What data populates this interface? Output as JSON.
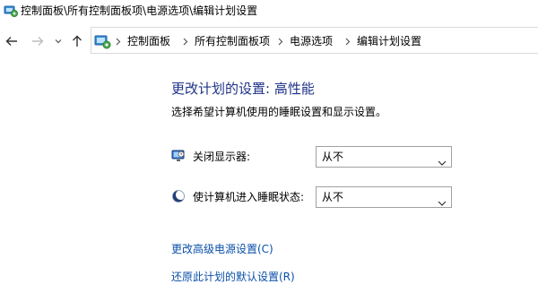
{
  "window": {
    "title": "控制面板\\所有控制面板项\\电源选项\\编辑计划设置",
    "title_icon": "control-panel-icon"
  },
  "navigation": {
    "back_icon": "back-arrow-icon",
    "forward_icon": "forward-arrow-icon",
    "recent_icon": "chevron-down-icon",
    "up_icon": "up-arrow-icon"
  },
  "breadcrumb": {
    "icon": "control-panel-icon",
    "items": [
      "控制面板",
      "所有控制面板项",
      "电源选项",
      "编辑计划设置"
    ]
  },
  "main": {
    "heading": "更改计划的设置: 高性能",
    "subheading": "选择希望计算机使用的睡眠设置和显示设置。",
    "settings": [
      {
        "label": "关闭显示器:",
        "icon": "monitor-icon",
        "value": "从不"
      },
      {
        "label": "使计算机进入睡眠状态:",
        "icon": "moon-sleep-icon",
        "value": "从不"
      }
    ],
    "links": [
      "更改高级电源设置(C)",
      "还原此计划的默认设置(R)"
    ]
  },
  "colors": {
    "heading": "#1e3287",
    "link": "#0a4fa8",
    "border": "#a0a0a0"
  }
}
